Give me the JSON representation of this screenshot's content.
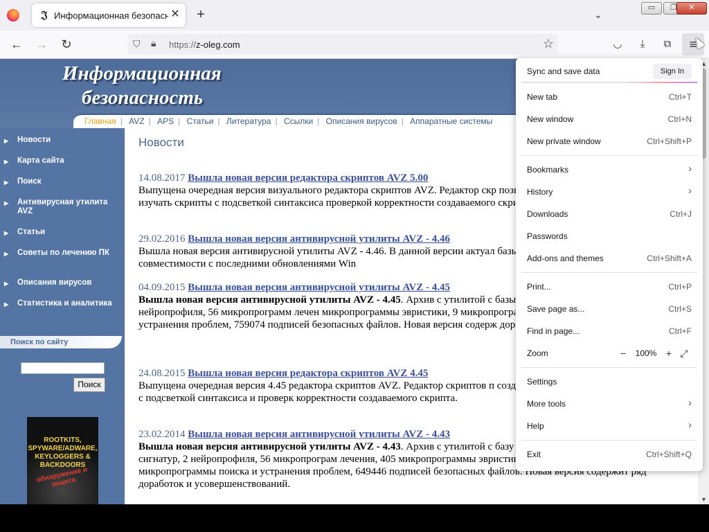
{
  "browser": {
    "tab": {
      "title": "Информационная безопасность",
      "favicon_icon": "𝔍"
    },
    "address": {
      "protocol": "https://",
      "host": "z-oleg.com"
    }
  },
  "site": {
    "title_line1": "Информационная",
    "title_line2": "безопасность",
    "top_nav": [
      {
        "label": "Главная",
        "active": true
      },
      {
        "label": "AVZ"
      },
      {
        "label": "APS"
      },
      {
        "label": "Статьи"
      },
      {
        "label": "Литература"
      },
      {
        "label": "Ссылки"
      },
      {
        "label": "Описания вирусов"
      },
      {
        "label": "Аппаратные системы"
      }
    ],
    "left_nav": [
      {
        "label": "Новости"
      },
      {
        "label": "Карта сайта"
      },
      {
        "label": "Поиск"
      },
      {
        "label": "Антивирусная утилита AVZ"
      },
      {
        "label": "Статьи"
      },
      {
        "label": "Советы по лечению ПК"
      },
      {
        "label": "Описания вирусов"
      },
      {
        "label": "Статистика и аналитика"
      }
    ],
    "search": {
      "header": "Поиск по сайту",
      "button": "Поиск"
    },
    "book": {
      "title": "ROOTKITS, SPYWARE/ADWARE, KEYLOGGERS & BACKDOORS",
      "subtitle": "обнаружение и защита"
    },
    "news_heading": "Новости",
    "news": [
      {
        "date": "14.08.2017",
        "title": "Вышла новая версия редактора скриптов AVZ 5.00",
        "body_lead": "",
        "body": "Выпущена очередная версия визуального редактора скриптов AVZ. Редактор скр позволяет создавать, редактировать и изучать скрипты с подсветкой синтаксиса проверкой корректности создаваемого скрипта."
      },
      {
        "date": "29.02.2016",
        "title": "Вышла новая версия антивирусной утилиты AVZ - 4.46",
        "body_lead": "",
        "body": "Вышла новая версия антивирусной утилиты AVZ - 4.46. В данной версии актуал базы и внесены доработки для совместимости с последними обновлениями Win"
      },
      {
        "date": "04.09.2015",
        "title": "Вышла новая версия антивирусной утилиты AVZ - 4.45",
        "body_lead": "Вышла новая версия антивирусной утилиты AVZ - 4.45",
        "body": ". Архив с утилитой с базы от 4.09.2015 - 297614 сигнатур, 2 нейропрофиля, 56 микропрограмм лечен микропрограммы эвристики, 9 микропрограмм ИПУ, 339 микропрограммы поис устранения проблем, 759074 подписей безопасных файлов. Новая версия содерж доработок и усовершенствований."
      },
      {
        "date": "24.08.2015",
        "title": "Вышла новая версия редактора скриптов AVZ 4.45",
        "body_lead": "",
        "body": "Выпущена очередная версия 4.45 редактора скриптов AVZ. Редактор скриптов п создавать, редактировать и изучать скрипты с подсветкой синтаксиса и проверк корректности создаваемого скрипта."
      },
      {
        "date": "23.02.2014",
        "title": "Вышла новая версия антивирусной утилиты AVZ - 4.43",
        "body_lead": "Вышла новая версия антивирусной утилиты AVZ - 4.43",
        "body": ". Архив с утилитой с базу вирусов от 23.02.2014 - 297614 сигнатур, 2 нейропрофиля, 56 микропрограм лечения, 405 микропрограммы эвристики, 9 микропрограмм ИПУ, 236 микропрограммы поиска и устранения проблем, 649446 подписей безопасных файлов. Новая версия содержит ряд доработок и усовершенствований."
      }
    ]
  },
  "menu": {
    "sync_label": "Sync and save data",
    "sign_in": "Sign In",
    "items": [
      {
        "id": "new-tab",
        "label": "New tab",
        "shortcut": "Ctrl+T"
      },
      {
        "id": "new-window",
        "label": "New window",
        "shortcut": "Ctrl+N"
      },
      {
        "id": "new-private-window",
        "label": "New private window",
        "shortcut": "Ctrl+Shift+P"
      },
      {
        "id": "bookmarks",
        "label": "Bookmarks",
        "submenu": true
      },
      {
        "id": "history",
        "label": "History",
        "submenu": true
      },
      {
        "id": "downloads",
        "label": "Downloads",
        "shortcut": "Ctrl+J"
      },
      {
        "id": "passwords",
        "label": "Passwords"
      },
      {
        "id": "addons",
        "label": "Add-ons and themes",
        "shortcut": "Ctrl+Shift+A"
      },
      {
        "id": "print",
        "label": "Print...",
        "shortcut": "Ctrl+P"
      },
      {
        "id": "save-page",
        "label": "Save page as...",
        "shortcut": "Ctrl+S"
      },
      {
        "id": "find-in-page",
        "label": "Find in page...",
        "shortcut": "Ctrl+F"
      },
      {
        "id": "zoom",
        "label": "Zoom",
        "zoom_value": "100%"
      },
      {
        "id": "settings",
        "label": "Settings"
      },
      {
        "id": "more-tools",
        "label": "More tools",
        "submenu": true
      },
      {
        "id": "help",
        "label": "Help",
        "submenu": true
      },
      {
        "id": "exit",
        "label": "Exit",
        "shortcut": "Ctrl+Shift+Q"
      }
    ]
  },
  "colors": {
    "site_blue": "#5474a3",
    "link": "#3a4f9a",
    "active_nav": "#e2a21a"
  }
}
